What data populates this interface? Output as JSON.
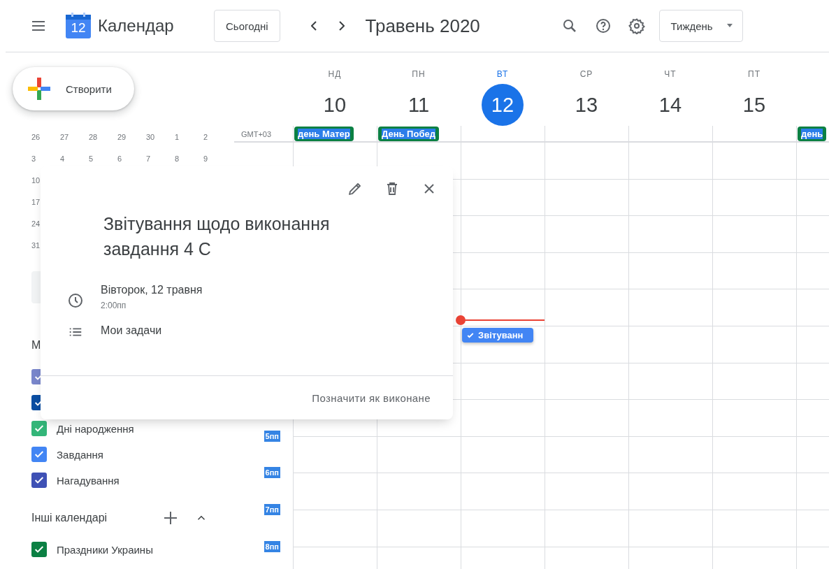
{
  "header": {
    "logo_day": "12",
    "app_name": "Календар",
    "today_button": "Сьогодні",
    "period": "Травень 2020",
    "view_menu": "Тиждень"
  },
  "create_button": "Створити",
  "mini_calendar": {
    "rows": [
      [
        "26",
        "27",
        "28",
        "29",
        "30",
        "1",
        "2"
      ],
      [
        "3",
        "4",
        "5",
        "6",
        "7",
        "8",
        "9"
      ],
      [
        "10"
      ],
      [
        "17"
      ],
      [
        "24"
      ],
      [
        "31"
      ]
    ]
  },
  "my_calendars": {
    "title": "М",
    "items": [
      {
        "color": "#7986cb",
        "checked": true
      },
      {
        "color": "#0b4ea2",
        "checked": true
      },
      {
        "label": "Дні народження",
        "color": "#33b679",
        "checked": true
      },
      {
        "label": "Завдання",
        "color": "#4285f4",
        "checked": true
      },
      {
        "label": "Нагадування",
        "color": "#3f51b5",
        "checked": true
      }
    ]
  },
  "other_calendars": {
    "title": "Інші календарі",
    "expanded": true,
    "items": [
      {
        "label": "Праздники Украины",
        "color": "#0b8043",
        "checked": true
      }
    ]
  },
  "timezone": "GMT+03",
  "time_labels": [
    "5пп",
    "6пп",
    "7пп",
    "8пп"
  ],
  "days": [
    {
      "name": "НД",
      "number": "10",
      "selected": false,
      "all_day": "день Матер"
    },
    {
      "name": "ПН",
      "number": "11",
      "selected": false,
      "all_day": "День Побед"
    },
    {
      "name": "ВТ",
      "number": "12",
      "selected": true,
      "current_time": true,
      "tasks": [
        {
          "title": "Звітуванн"
        }
      ]
    },
    {
      "name": "СР",
      "number": "13",
      "selected": false
    },
    {
      "name": "ЧТ",
      "number": "14",
      "selected": false
    },
    {
      "name": "ПТ",
      "number": "15",
      "selected": false
    },
    {
      "all_day": "день"
    }
  ],
  "popup": {
    "title": "Звітування щодо виконання завдання 4 С",
    "date": "Вівторок, 12 травня",
    "time": "2:00пп",
    "list": "Мои задачи",
    "action": "Позначити як виконане"
  }
}
